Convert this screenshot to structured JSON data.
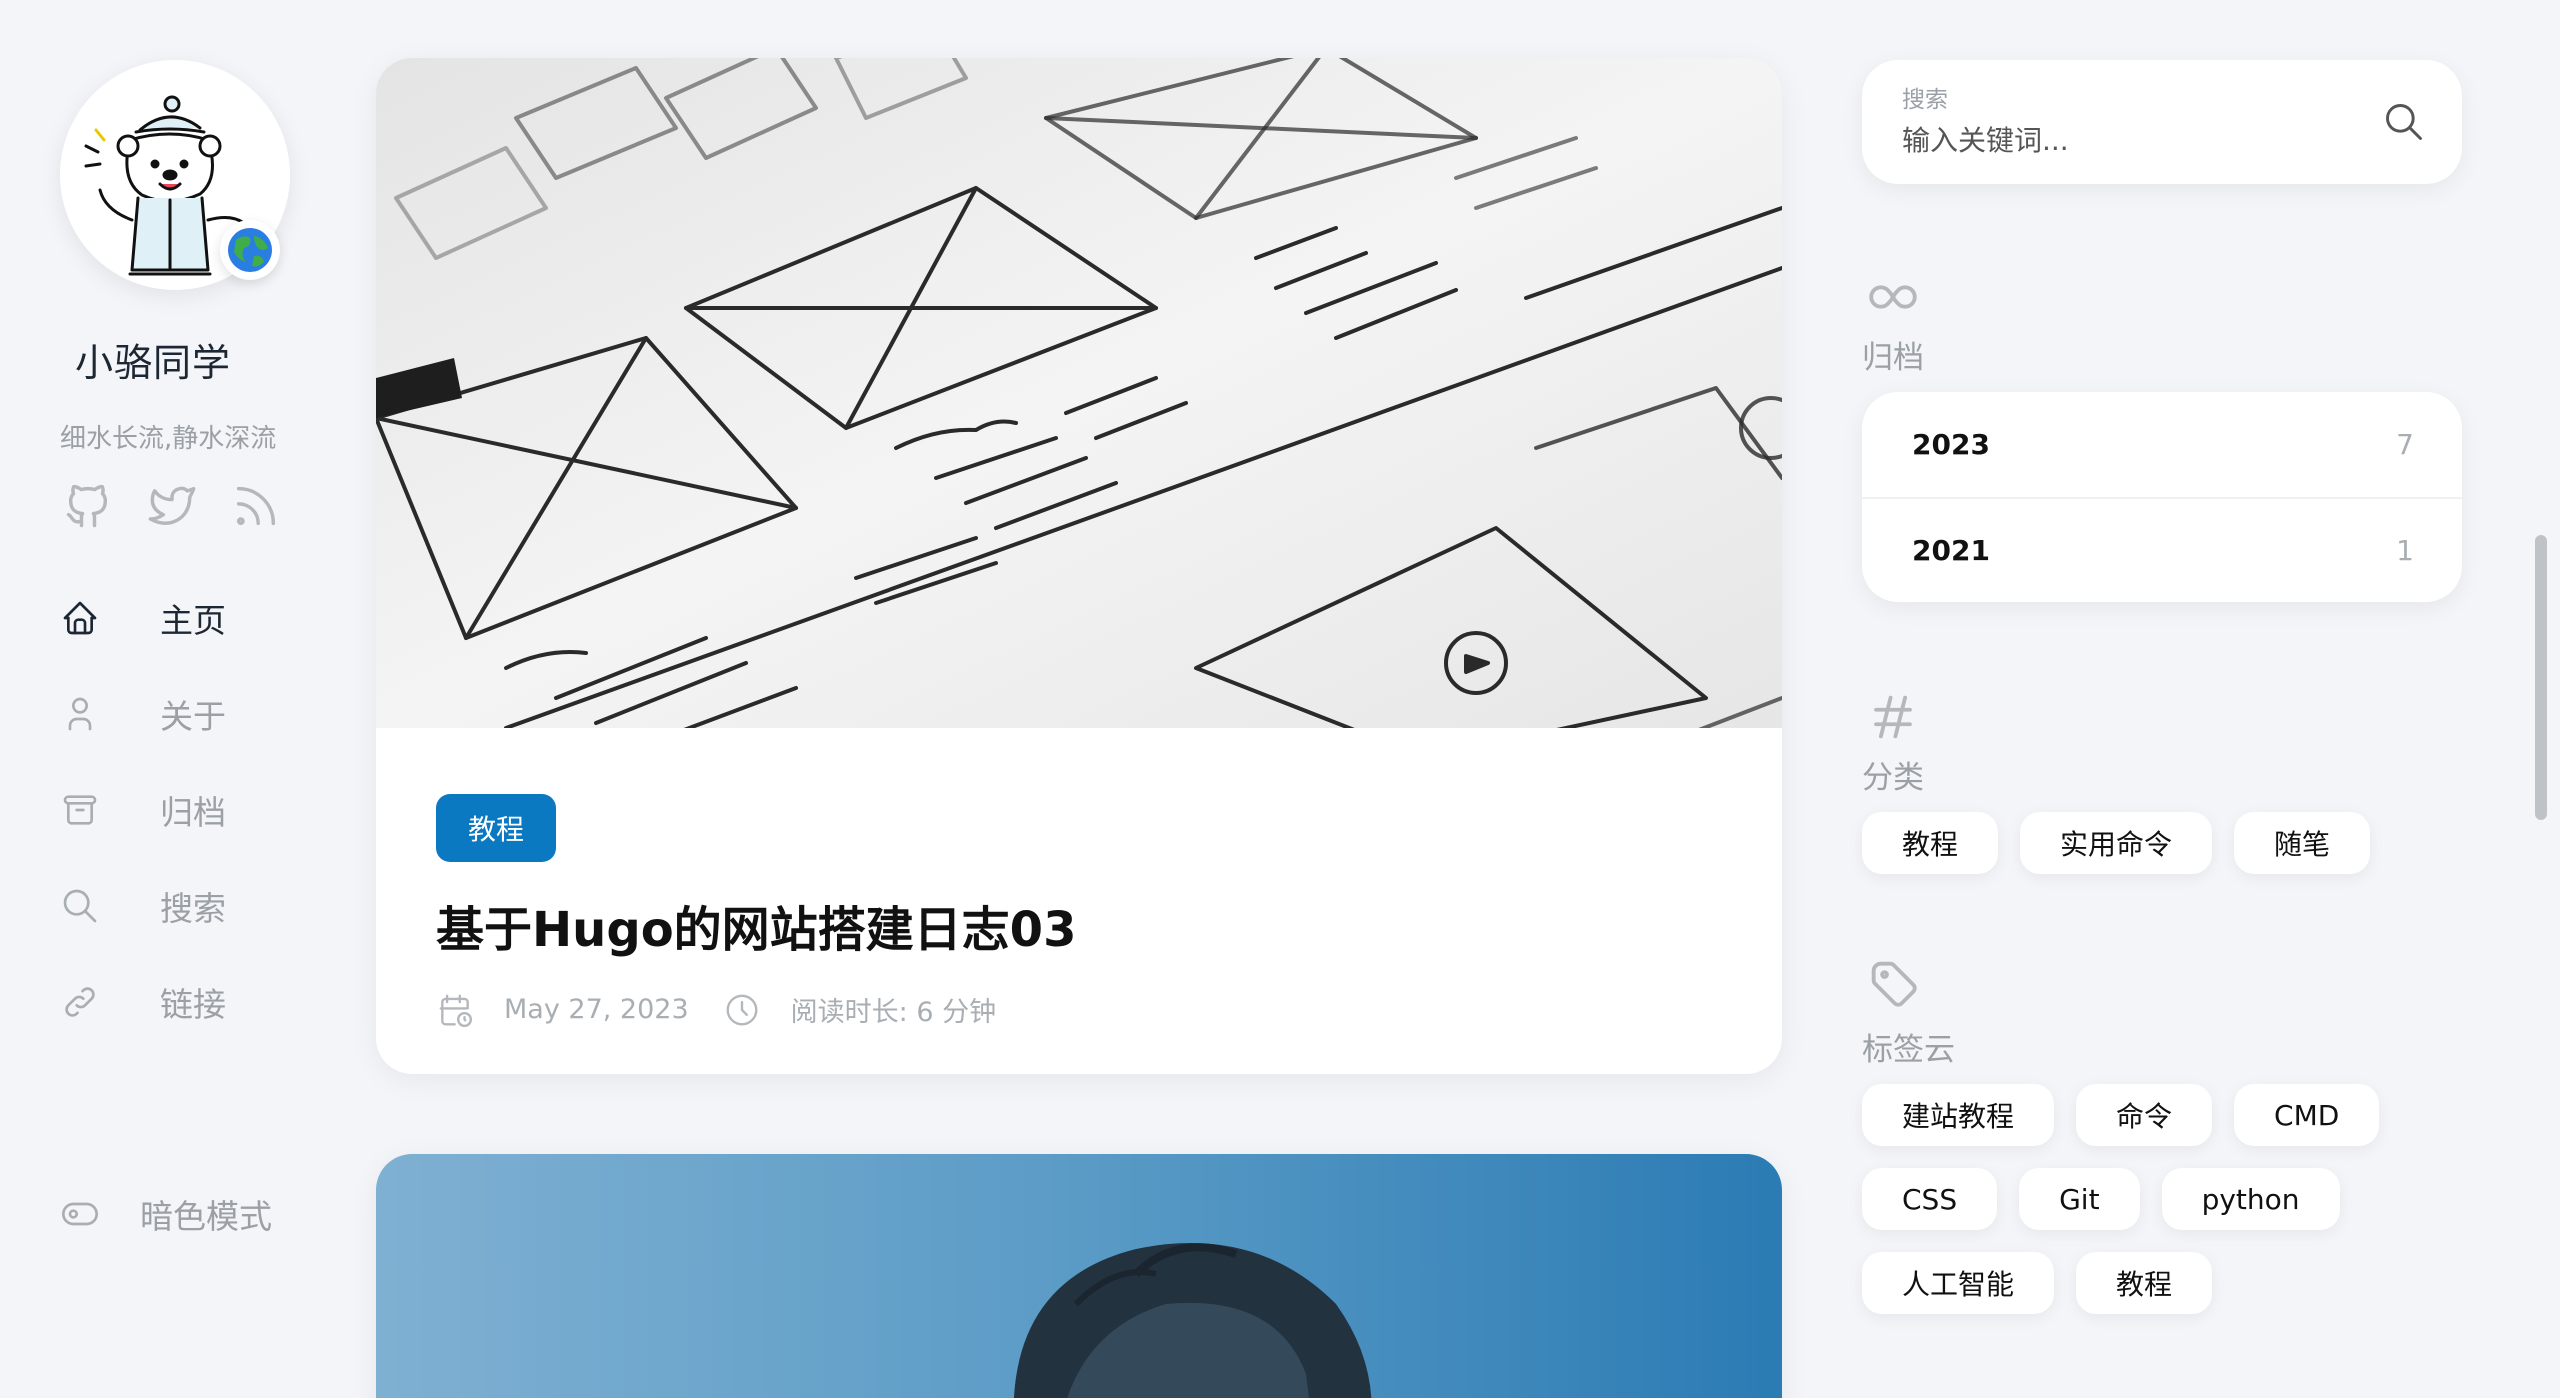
{
  "profile": {
    "name": "小骆同学",
    "description": "细水长流,静水深流",
    "badge_emoji": "🌍"
  },
  "social": [
    {
      "name": "github-icon"
    },
    {
      "name": "twitter-icon"
    },
    {
      "name": "rss-icon"
    }
  ],
  "menu": [
    {
      "label": "主页",
      "icon": "home-icon",
      "active": true
    },
    {
      "label": "关于",
      "icon": "user-icon",
      "active": false
    },
    {
      "label": "归档",
      "icon": "archive-icon",
      "active": false
    },
    {
      "label": "搜索",
      "icon": "search-icon",
      "active": false
    },
    {
      "label": "链接",
      "icon": "link-icon",
      "active": false
    }
  ],
  "dark_mode": {
    "label": "暗色模式",
    "icon": "toggle-icon"
  },
  "posts": [
    {
      "category": "教程",
      "title": "基于Hugo的网站搭建日志03",
      "date": "May 27, 2023",
      "reading_time": "阅读时长: 6 分钟"
    }
  ],
  "search": {
    "label": "搜索",
    "placeholder": "输入关键词..."
  },
  "archives": {
    "title": "归档",
    "items": [
      {
        "year": "2023",
        "count": "7"
      },
      {
        "year": "2021",
        "count": "1"
      }
    ]
  },
  "categories": {
    "title": "分类",
    "items": [
      "教程",
      "实用命令",
      "随笔"
    ]
  },
  "tags": {
    "title": "标签云",
    "items": [
      "建站教程",
      "命令",
      "CMD",
      "CSS",
      "Git",
      "python",
      "人工智能",
      "教程"
    ]
  },
  "colors": {
    "accent": "#0b78c2",
    "background": "#f4f5f8",
    "muted": "#9aa0a6"
  }
}
